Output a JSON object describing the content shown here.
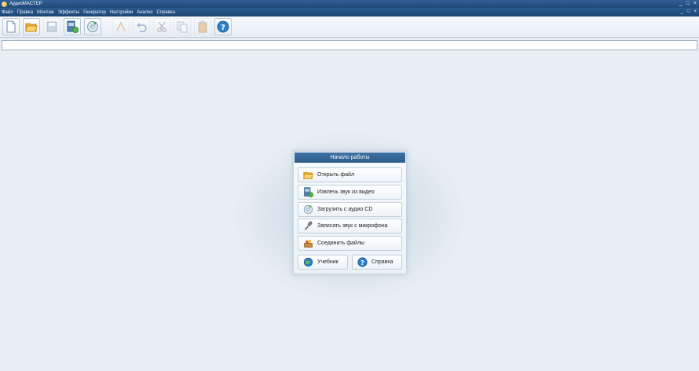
{
  "window": {
    "title": "АудиоМАСТЕР",
    "controls": [
      "_",
      "□",
      "×"
    ],
    "mdi_controls": [
      "_",
      "□",
      "×"
    ]
  },
  "menu": [
    "Файл",
    "Правка",
    "Монтаж",
    "Эффекты",
    "Генератор",
    "Настройки",
    "Анализ",
    "Справка"
  ],
  "toolbar": {
    "buttons": [
      {
        "icon": "new-file-icon",
        "enabled": true
      },
      {
        "icon": "open-folder-icon",
        "enabled": true
      },
      {
        "icon": "save-icon",
        "enabled": false
      },
      {
        "icon": "extract-video-sound-icon",
        "enabled": true
      },
      {
        "icon": "cd-load-icon",
        "enabled": true
      },
      {
        "icon": "effects-icon",
        "enabled": false
      },
      {
        "icon": "undo-icon",
        "enabled": false
      },
      {
        "icon": "cut-icon",
        "enabled": false
      },
      {
        "icon": "copy-icon",
        "enabled": false
      },
      {
        "icon": "paste-icon",
        "enabled": false
      },
      {
        "icon": "help-icon",
        "enabled": true
      }
    ]
  },
  "start_panel": {
    "title": "Начало работы",
    "open_file": "Открыть файл",
    "extract_video": "Извлечь звук из видео",
    "load_cd": "Загрузить с аудио CD",
    "record_mic": "Записать звук с микрофона",
    "join_files": "Соединить файлы",
    "tutorial": "Учебник",
    "help": "Справка"
  }
}
